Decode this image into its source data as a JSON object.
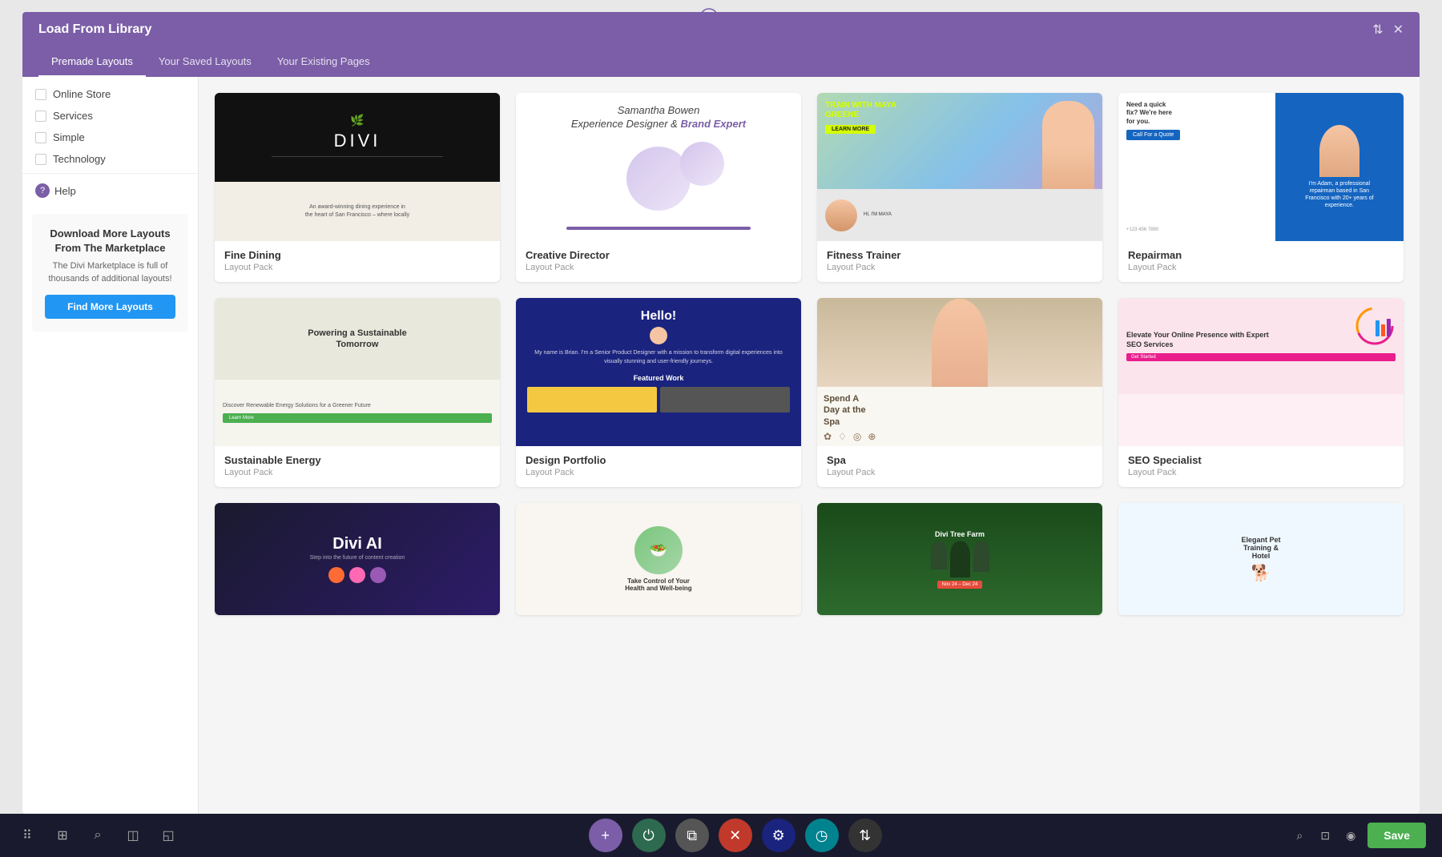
{
  "modal": {
    "title": "Load From Library",
    "tabs": [
      {
        "label": "Premade Layouts",
        "active": true
      },
      {
        "label": "Your Saved Layouts",
        "active": false
      },
      {
        "label": "Your Existing Pages",
        "active": false
      }
    ]
  },
  "sidebar": {
    "categories": [
      {
        "label": "Online Store",
        "checked": false
      },
      {
        "label": "Services",
        "checked": false
      },
      {
        "label": "Simple",
        "checked": false
      },
      {
        "label": "Technology",
        "checked": false
      }
    ],
    "help_label": "Help",
    "marketplace": {
      "title": "Download More Layouts From The Marketplace",
      "description": "The Divi Marketplace is full of thousands of additional layouts!",
      "button_label": "Find More Layouts"
    }
  },
  "layouts": [
    {
      "name": "Fine Dining",
      "type": "Layout Pack",
      "preview_type": "fine-dining"
    },
    {
      "name": "Creative Director",
      "type": "Layout Pack",
      "preview_type": "creative-director"
    },
    {
      "name": "Fitness Trainer",
      "type": "Layout Pack",
      "preview_type": "fitness"
    },
    {
      "name": "Repairman",
      "type": "Layout Pack",
      "preview_type": "repairman"
    },
    {
      "name": "Sustainable Energy",
      "type": "Layout Pack",
      "preview_type": "sustainable"
    },
    {
      "name": "Design Portfolio",
      "type": "Layout Pack",
      "preview_type": "design-portfolio"
    },
    {
      "name": "Spa",
      "type": "Layout Pack",
      "preview_type": "spa"
    },
    {
      "name": "SEO Specialist",
      "type": "Layout Pack",
      "preview_type": "seo"
    }
  ],
  "partial_layouts": [
    {
      "name": "Divi AI",
      "preview_type": "divi-ai"
    },
    {
      "name": "Health & Wellbeing",
      "preview_type": "health"
    },
    {
      "name": "Divi Tree Farm",
      "preview_type": "tree-farm"
    },
    {
      "name": "Elegant Pet Training & Hotel",
      "preview_type": "pet"
    }
  ],
  "toolbar": {
    "save_label": "Save",
    "icons": [
      "⠿",
      "⊞",
      "⌕",
      "◫",
      "◱"
    ]
  }
}
